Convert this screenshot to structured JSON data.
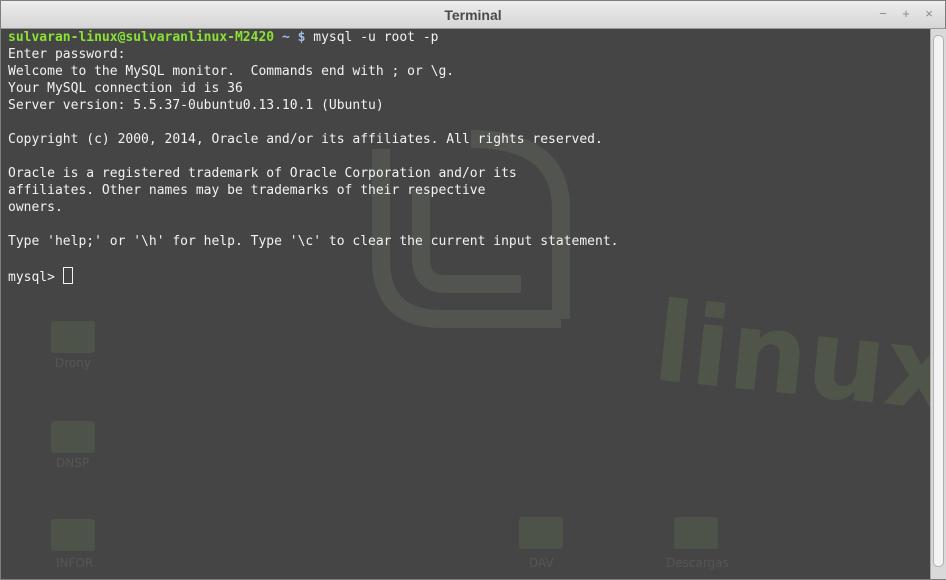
{
  "window": {
    "title": "Terminal",
    "controls": [
      "−",
      "+",
      "×"
    ]
  },
  "terminal": {
    "prompt_user": "sulvaran-linux@sulvaranlinux-M2420",
    "prompt_dir": "~",
    "prompt_symbol": "$",
    "command": " mysql -u root -p",
    "lines": [
      "Enter password:",
      "Welcome to the MySQL monitor.  Commands end with ; or \\g.",
      "Your MySQL connection id is 36",
      "Server version: 5.5.37-0ubuntu0.13.10.1 (Ubuntu)",
      "",
      "Copyright (c) 2000, 2014, Oracle and/or its affiliates. All rights reserved.",
      "",
      "Oracle is a registered trademark of Oracle Corporation and/or its",
      "affiliates. Other names may be trademarks of their respective",
      "owners.",
      "",
      "Type 'help;' or '\\h' for help. Type '\\c' to clear the current input statement.",
      ""
    ],
    "mysql_prompt": "mysql> "
  },
  "desktop_bg": {
    "brand_text": "linux mint",
    "folder_labels": [
      "Drony",
      "DNSP",
      "INFOR",
      "DAV",
      "Descargas"
    ]
  },
  "colors": {
    "terminal_bg": "#454545",
    "text": "#f2f2f2",
    "prompt_user": "#8ae234",
    "prompt_path": "#9fbfe8"
  }
}
